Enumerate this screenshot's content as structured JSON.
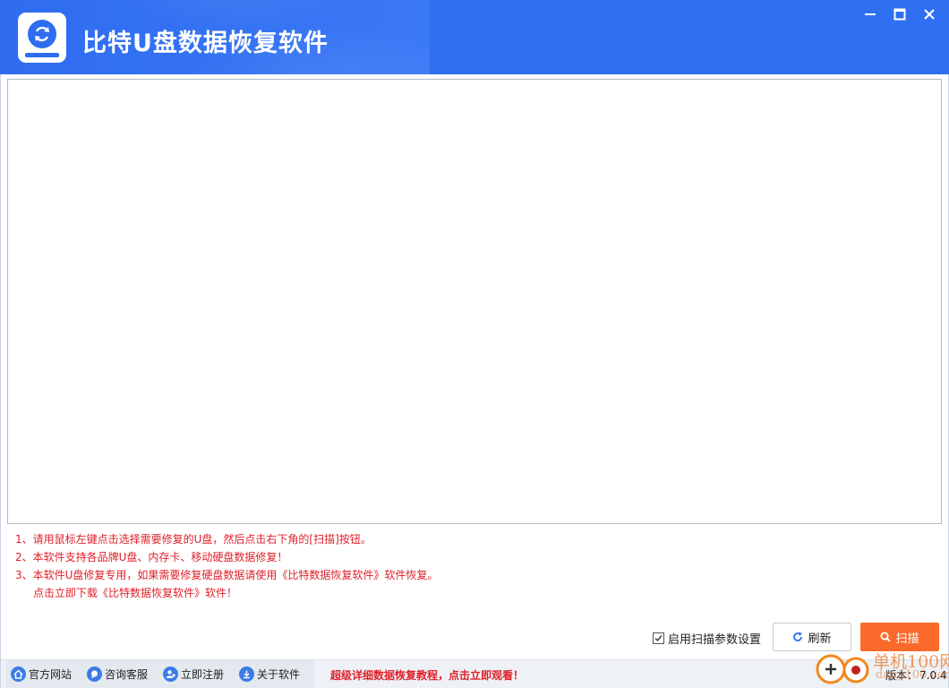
{
  "window": {
    "title": "比特U盘数据恢复软件",
    "controls": [
      "minimize",
      "maximize",
      "close"
    ]
  },
  "colors": {
    "title_bar": "#2f6ff2",
    "scan_button": "#fb6a2a",
    "notice_text": "#e0202a",
    "icon_blue": "#3a7be6"
  },
  "notices": [
    "1、请用鼠标左键点击选择需要修复的U盘，然后点击右下角的[扫描]按钮。",
    "2、本软件支持各品牌U盘、内存卡、移动硬盘数据修复！",
    "3、本软件U盘修复专用，如果需要修复硬盘数据请使用《比特数据恢复软件》软件恢复。",
    "点击立即下载《比特数据恢复软件》软件！"
  ],
  "controls": {
    "scan_params_label": "启用扫描参数设置",
    "scan_params_checked": true,
    "refresh_label": "刷新",
    "scan_label": "扫描"
  },
  "statusbar": {
    "links": [
      {
        "label": "官方网站",
        "icon": "home-icon"
      },
      {
        "label": "咨询客服",
        "icon": "chat-icon"
      },
      {
        "label": "立即注册",
        "icon": "user-add-icon"
      },
      {
        "label": "关于软件",
        "icon": "info-icon"
      }
    ],
    "tutorial": "超级详细数据恢复教程，点击立即观看！",
    "version_label": "版本：",
    "version_value": "7.0.4"
  },
  "watermark": {
    "text": "单机100网",
    "sub": "danji100.com"
  }
}
